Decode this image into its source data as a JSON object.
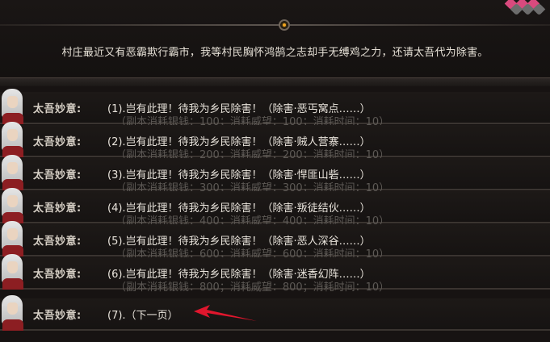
{
  "intro_text": "村庄最近又有恶霸欺行霸市，我等村民胸怀鸿鹄之志却手无缚鸡之力，还请太吾代为除害。",
  "speaker": "太吾妙意:",
  "options": [
    {
      "main": "(1).岂有此理！待我为乡民除害！（除害·恶丐窝点……）",
      "sub": "（副本消耗银钱：100；消耗威望：100；消耗时间：10）"
    },
    {
      "main": "(2).岂有此理！待我为乡民除害！（除害·贼人营寨……）",
      "sub": "（副本消耗银钱：200；消耗威望：200；消耗时间：10）"
    },
    {
      "main": "(3).岂有此理！待我为乡民除害！（除害·悍匪山砦……）",
      "sub": "（副本消耗银钱：300；消耗威望：300；消耗时间：10）"
    },
    {
      "main": "(4).岂有此理！待我为乡民除害！（除害·叛徒结伙……）",
      "sub": "（副本消耗银钱：400；消耗威望：400；消耗时间：10）"
    },
    {
      "main": "(5).岂有此理！待我为乡民除害！（除害·恶人深谷……）",
      "sub": "（副本消耗银钱：600；消耗威望：600；消耗时间：10）"
    },
    {
      "main": "(6).岂有此理！待我为乡民除害！（除害·迷香幻阵……）",
      "sub": "（副本消耗银钱：800；消耗威望：800；消耗时间：10）"
    },
    {
      "main": "(7).（下一页）",
      "sub": ""
    }
  ],
  "colors": {
    "arrow": "#e0162d",
    "heart_pink": "#d94a7e",
    "gem": "#f2a51f"
  }
}
